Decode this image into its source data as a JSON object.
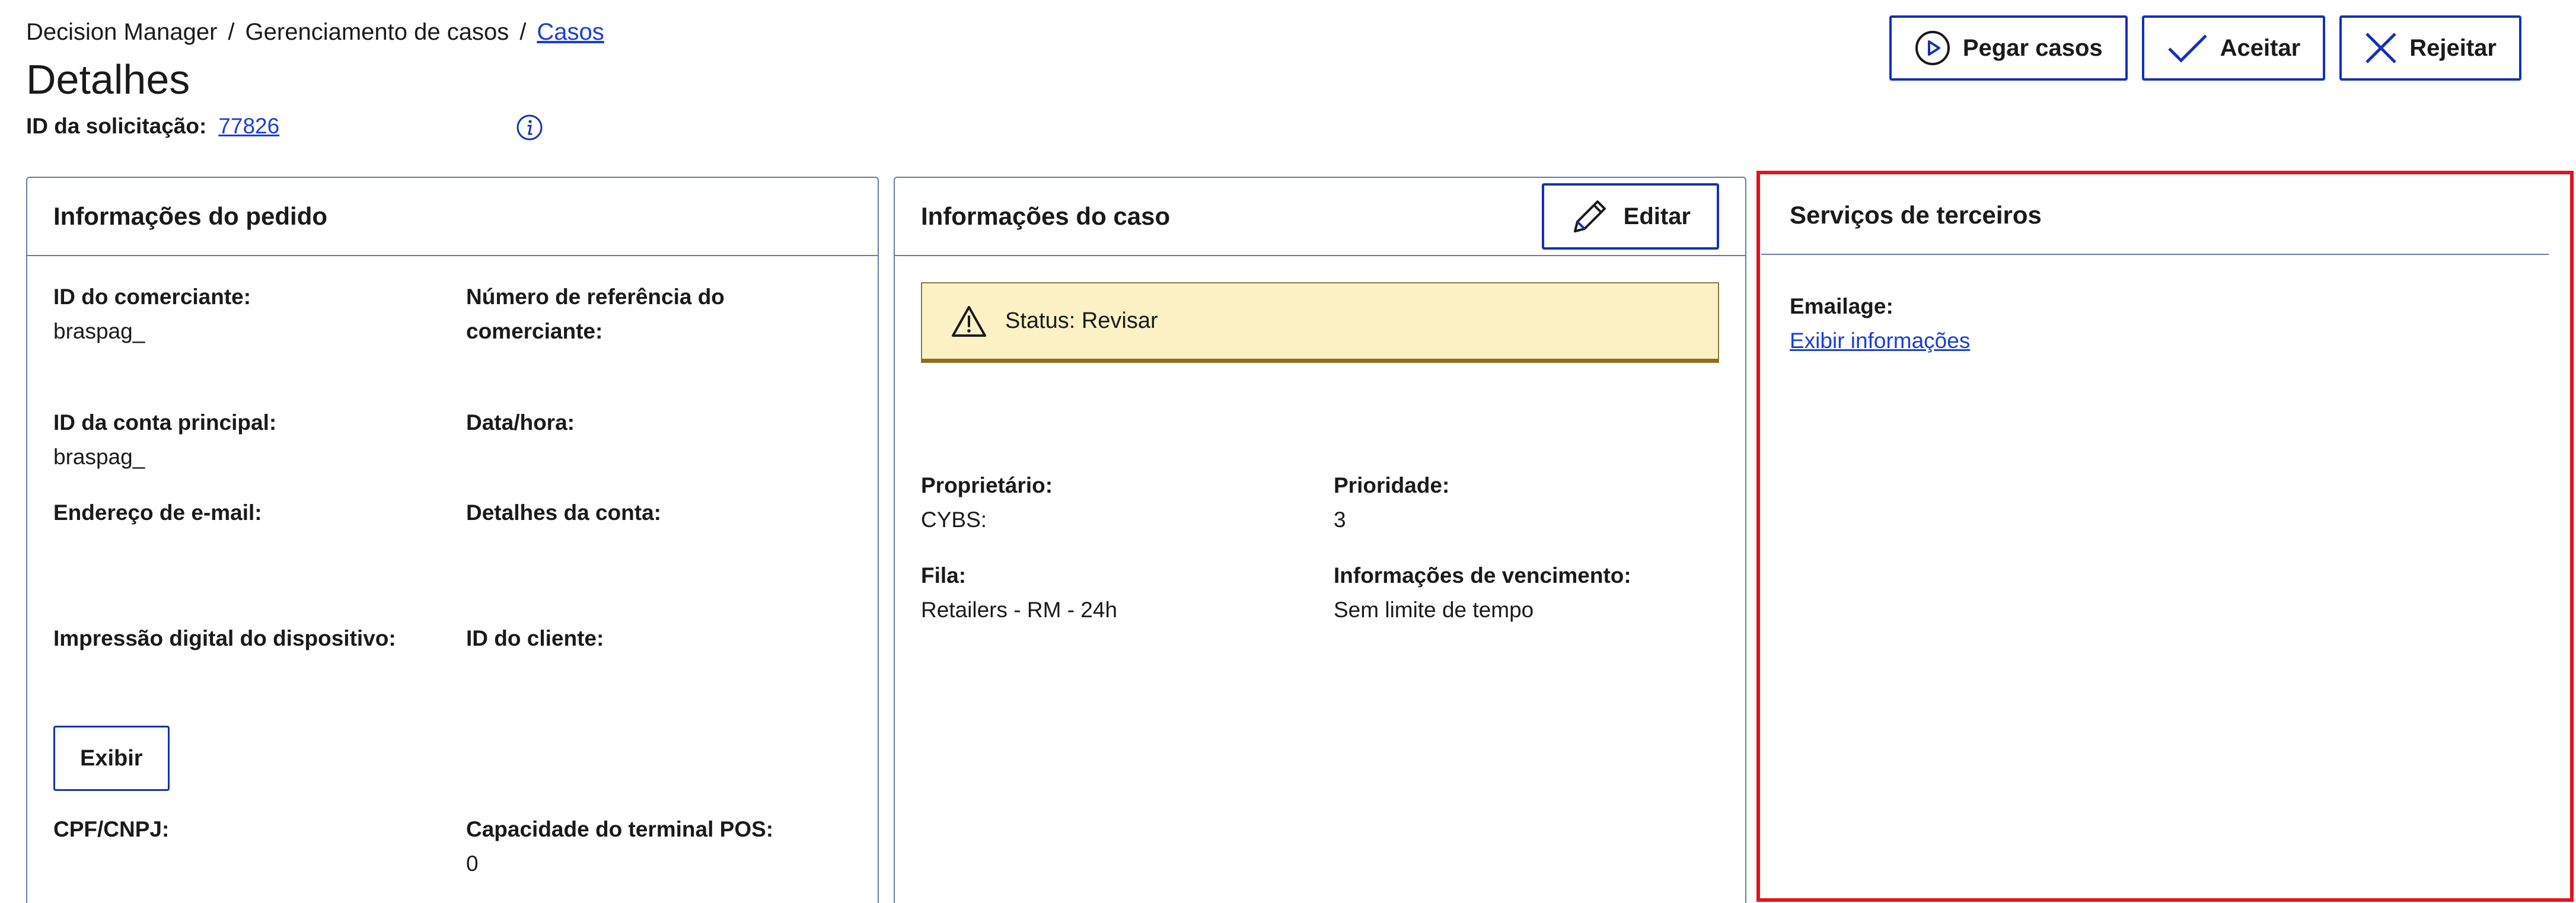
{
  "breadcrumb": {
    "item1": "Decision Manager",
    "sep": "/",
    "item2": "Gerenciamento de casos",
    "item3": "Casos"
  },
  "page": {
    "title": "Detalhes",
    "request_id_label": "ID da solicitação:",
    "request_id_value": "77826"
  },
  "actions": {
    "take_cases": "Pegar casos",
    "accept": "Aceitar",
    "reject": "Rejeitar"
  },
  "order_info": {
    "title": "Informações do pedido",
    "merchant_id_label": "ID do comerciante:",
    "merchant_id_value": "braspag_",
    "merchant_ref_label": "Número de referência do comerciante:",
    "main_account_label": "ID da conta principal:",
    "main_account_value": "braspag_",
    "datetime_label": "Data/hora:",
    "email_label": "Endereço de e-mail:",
    "account_details_label": "Detalhes da conta:",
    "device_fingerprint_label": "Impressão digital do dispositivo:",
    "customer_id_label": "ID do cliente:",
    "show_button": "Exibir",
    "cpf_label": "CPF/CNPJ:",
    "pos_label": "Capacidade do terminal POS:",
    "pos_value": "0"
  },
  "case_info": {
    "title": "Informações do caso",
    "edit_button": "Editar",
    "status": "Status: Revisar",
    "owner_label": "Proprietário:",
    "owner_value": "CYBS:",
    "priority_label": "Prioridade:",
    "priority_value": "3",
    "queue_label": "Fila:",
    "queue_value": "Retailers - RM - 24h",
    "due_label": "Informações de vencimento:",
    "due_value": "Sem limite de tempo"
  },
  "third_party": {
    "title": "Serviços de terceiros",
    "emailage_label": "Emailage:",
    "emailage_link": "Exibir informações"
  },
  "colors": {
    "accent": "#1530b8",
    "link": "#1a3fd6",
    "status_bg": "#fbf1c4",
    "highlight": "#e0141e"
  }
}
